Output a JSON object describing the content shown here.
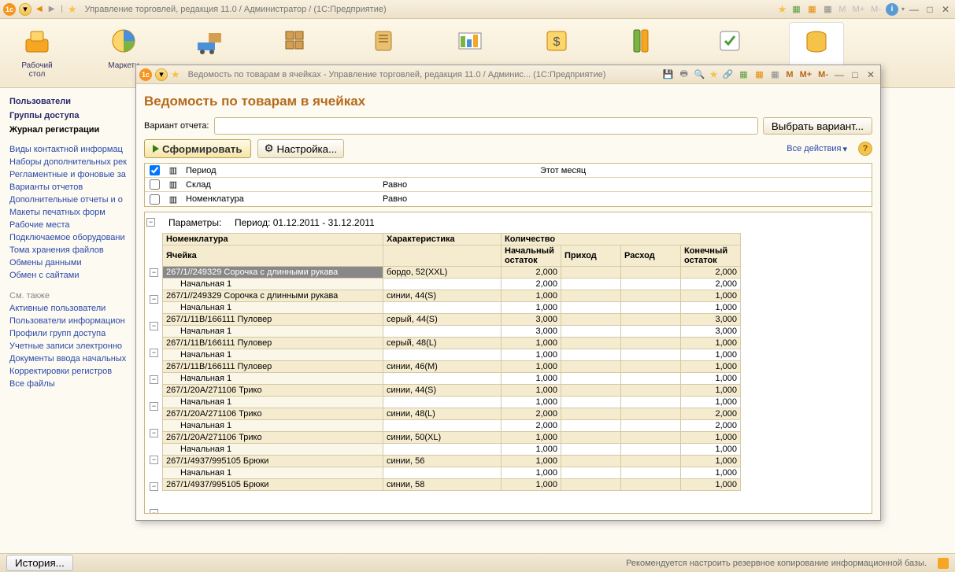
{
  "main_window": {
    "title": "Управление торговлей, редакция 11.0 / Администратор /  (1С:Предприятие)",
    "m_buttons": [
      "M",
      "M+",
      "M-"
    ]
  },
  "toolbar": [
    {
      "label": "Рабочий\nстол"
    },
    {
      "label": "Маркети"
    },
    {
      "label": ""
    },
    {
      "label": ""
    },
    {
      "label": ""
    },
    {
      "label": ""
    },
    {
      "label": ""
    },
    {
      "label": ""
    },
    {
      "label": ""
    },
    {
      "label": ""
    }
  ],
  "sidebar": {
    "main_items": [
      "Пользователи",
      "Группы доступа",
      "Журнал регистрации"
    ],
    "links": [
      "Виды контактной информац",
      "Наборы дополнительных рек",
      "Регламентные и фоновые за",
      "Варианты отчетов",
      "Дополнительные отчеты и о",
      "Макеты печатных форм",
      "Рабочие места",
      "Подключаемое оборудовани",
      "Тома хранения файлов",
      "Обмены данными",
      "Обмен с сайтами"
    ],
    "see_also_title": "См. также",
    "see_also": [
      "Активные пользователи",
      "Пользователи информацион",
      "Профили групп доступа",
      "Учетные записи электронно",
      "Документы ввода начальных",
      "Корректировки регистров",
      "Все файлы"
    ]
  },
  "footer": {
    "history": "История...",
    "message": "Рекомендуется настроить резервное копирование информационной базы."
  },
  "report_window": {
    "header_title": "Ведомость по товарам в ячейках - Управление торговлей, редакция 11.0 / Админис...  (1С:Предприятие)",
    "m_buttons": [
      "M",
      "M+",
      "M-"
    ],
    "title": "Ведомость по товарам в ячейках",
    "variant_label": "Вариант отчета:",
    "choose_variant": "Выбрать вариант...",
    "form_btn": "Сформировать",
    "settings_btn": "Настройка...",
    "all_actions": "Все действия",
    "filters": [
      {
        "checked": true,
        "name": "Период",
        "cond": "",
        "val": "Этот месяц"
      },
      {
        "checked": false,
        "name": "Склад",
        "cond": "Равно",
        "val": ""
      },
      {
        "checked": false,
        "name": "Номенклатура",
        "cond": "Равно",
        "val": ""
      }
    ],
    "params_label": "Параметры:",
    "params_value": "Период: 01.12.2011 - 31.12.2011",
    "columns": {
      "nomen": "Номенклатура",
      "cell": "Ячейка",
      "char": "Характеристика",
      "qty": "Количество",
      "start_bal": "Начальный остаток",
      "income": "Приход",
      "expense": "Расход",
      "end_bal": "Конечный остаток"
    },
    "rows": [
      {
        "type": "group",
        "selected": true,
        "nomen": "267/1//249329 Сорочка с длинными рукава",
        "char": "бордо, 52(XXL)",
        "start": "2,000",
        "income": "",
        "expense": "",
        "end": "2,000"
      },
      {
        "type": "detail",
        "nomen": "Начальная 1",
        "char": "",
        "start": "2,000",
        "income": "",
        "expense": "",
        "end": "2,000"
      },
      {
        "type": "group",
        "nomen": "267/1//249329 Сорочка с длинными рукава",
        "char": "синии, 44(S)",
        "start": "1,000",
        "income": "",
        "expense": "",
        "end": "1,000"
      },
      {
        "type": "detail",
        "nomen": "Начальная 1",
        "char": "",
        "start": "1,000",
        "income": "",
        "expense": "",
        "end": "1,000"
      },
      {
        "type": "group",
        "nomen": "267/1/11В/166111 Пуловер",
        "char": "серый, 44(S)",
        "start": "3,000",
        "income": "",
        "expense": "",
        "end": "3,000"
      },
      {
        "type": "detail",
        "nomen": "Начальная 1",
        "char": "",
        "start": "3,000",
        "income": "",
        "expense": "",
        "end": "3,000"
      },
      {
        "type": "group",
        "nomen": "267/1/11В/166111 Пуловер",
        "char": "серый, 48(L)",
        "start": "1,000",
        "income": "",
        "expense": "",
        "end": "1,000"
      },
      {
        "type": "detail",
        "nomen": "Начальная 1",
        "char": "",
        "start": "1,000",
        "income": "",
        "expense": "",
        "end": "1,000"
      },
      {
        "type": "group",
        "nomen": "267/1/11В/166111 Пуловер",
        "char": "синии, 46(М)",
        "start": "1,000",
        "income": "",
        "expense": "",
        "end": "1,000"
      },
      {
        "type": "detail",
        "nomen": "Начальная 1",
        "char": "",
        "start": "1,000",
        "income": "",
        "expense": "",
        "end": "1,000"
      },
      {
        "type": "group",
        "nomen": "267/1/20А/271106 Трико",
        "char": "синии, 44(S)",
        "start": "1,000",
        "income": "",
        "expense": "",
        "end": "1,000"
      },
      {
        "type": "detail",
        "nomen": "Начальная 1",
        "char": "",
        "start": "1,000",
        "income": "",
        "expense": "",
        "end": "1,000"
      },
      {
        "type": "group",
        "nomen": "267/1/20А/271106 Трико",
        "char": "синии, 48(L)",
        "start": "2,000",
        "income": "",
        "expense": "",
        "end": "2,000"
      },
      {
        "type": "detail",
        "nomen": "Начальная 1",
        "char": "",
        "start": "2,000",
        "income": "",
        "expense": "",
        "end": "2,000"
      },
      {
        "type": "group",
        "nomen": "267/1/20А/271106 Трико",
        "char": "синии, 50(XL)",
        "start": "1,000",
        "income": "",
        "expense": "",
        "end": "1,000"
      },
      {
        "type": "detail",
        "nomen": "Начальная 1",
        "char": "",
        "start": "1,000",
        "income": "",
        "expense": "",
        "end": "1,000"
      },
      {
        "type": "group",
        "nomen": "267/1/4937/995105 Брюки",
        "char": "синии, 56",
        "start": "1,000",
        "income": "",
        "expense": "",
        "end": "1,000"
      },
      {
        "type": "detail",
        "nomen": "Начальная 1",
        "char": "",
        "start": "1,000",
        "income": "",
        "expense": "",
        "end": "1,000"
      },
      {
        "type": "group",
        "nomen": "267/1/4937/995105 Брюки",
        "char": "синии, 58",
        "start": "1,000",
        "income": "",
        "expense": "",
        "end": "1,000"
      }
    ]
  }
}
